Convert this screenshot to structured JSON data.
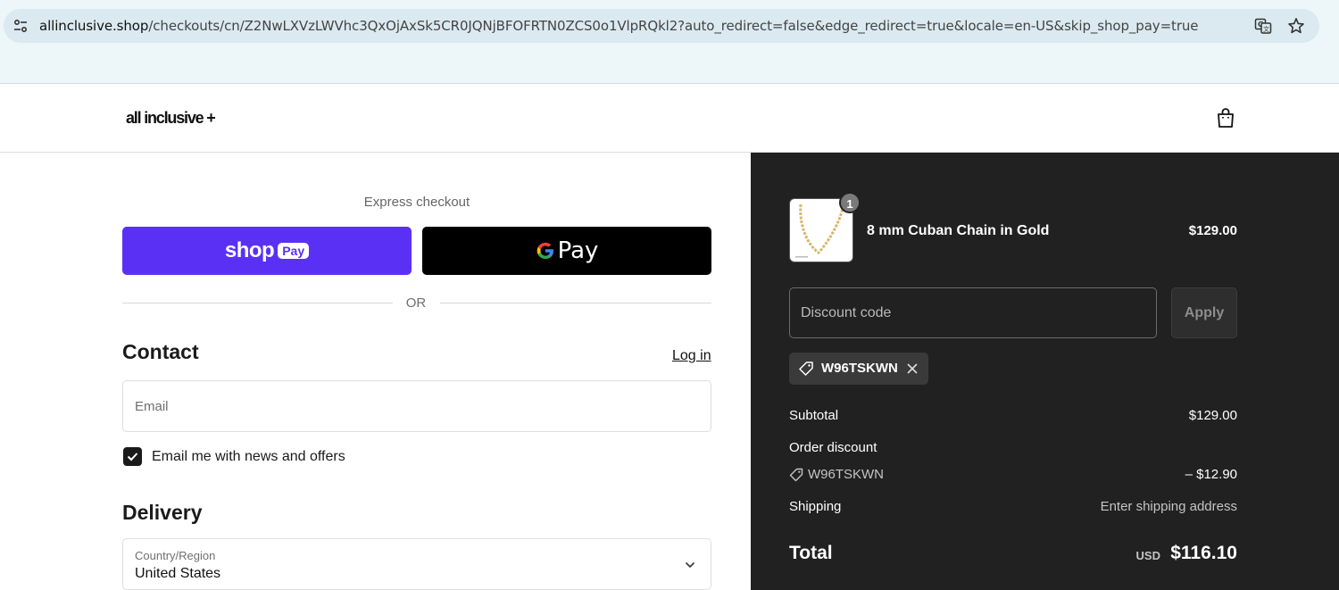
{
  "browser": {
    "url_host": "allinclusive.shop",
    "url_path": "/checkouts/cn/Z2NwLXVzLWVhc3QxOjAxSk5CR0JQNjBFOFRTN0ZCS0o1VlpRQkl2?auto_redirect=false&edge_redirect=true&locale=en-US&skip_shop_pay=true"
  },
  "header": {
    "logo": "all inclusive +"
  },
  "express": {
    "label": "Express checkout",
    "shop_pay_word": "shop",
    "shop_pay_pill": "Pay",
    "gpay_text": "Pay",
    "or_text": "OR",
    "shop_pay_color": "#5a31f4"
  },
  "contact": {
    "heading": "Contact",
    "login_link": "Log in",
    "email_placeholder": "Email",
    "newsletter_label": "Email me with news and offers",
    "newsletter_checked": true
  },
  "delivery": {
    "heading": "Delivery",
    "country_label": "Country/Region",
    "country_value": "United States"
  },
  "summary": {
    "product": {
      "quantity": "1",
      "name": "8 mm Cuban Chain in Gold",
      "price": "$129.00"
    },
    "discount_placeholder": "Discount code",
    "apply_label": "Apply",
    "applied_code": "W96TSKWN",
    "subtotal_label": "Subtotal",
    "subtotal_value": "$129.00",
    "order_discount_label": "Order discount",
    "discount_code": "W96TSKWN",
    "discount_value": "– $12.90",
    "shipping_label": "Shipping",
    "shipping_value": "Enter shipping address",
    "total_label": "Total",
    "total_currency": "USD",
    "total_value": "$116.10"
  }
}
